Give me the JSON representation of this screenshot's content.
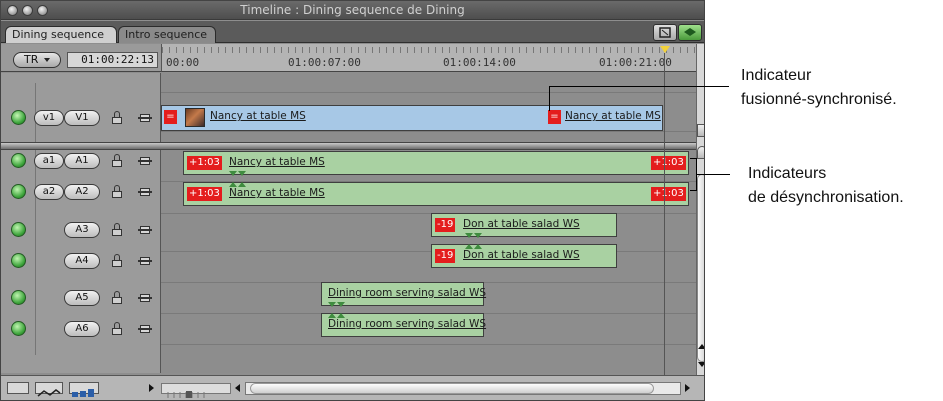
{
  "window": {
    "title": "Timeline : Dining sequence de Dining"
  },
  "tabs": [
    {
      "label": "Dining sequence",
      "active": true
    },
    {
      "label": "Intro sequence",
      "active": false
    }
  ],
  "header": {
    "rt_popup": "TR",
    "timecode": "01:00:22:13",
    "ruler_labels": [
      "00:00",
      "01:00:07:00",
      "01:00:14:00",
      "01:00:21:00"
    ]
  },
  "tracks": {
    "video": [
      {
        "src": "v1",
        "dst": "V1"
      }
    ],
    "audio": [
      {
        "src": "a1",
        "dst": "A1"
      },
      {
        "src": "a2",
        "dst": "A2"
      },
      {
        "src": "",
        "dst": "A3"
      },
      {
        "src": "",
        "dst": "A4"
      },
      {
        "src": "",
        "dst": "A5"
      },
      {
        "src": "",
        "dst": "A6"
      }
    ]
  },
  "clips": {
    "v1_a": {
      "name": "Nancy at table MS",
      "badge": "="
    },
    "v1_b": {
      "name": "Nancy at table MS",
      "badge": "="
    },
    "a1": {
      "name": "Nancy at table MS",
      "badge_in": "+1:03",
      "badge_out": "+1:03"
    },
    "a2": {
      "name": "Nancy at table MS",
      "badge_in": "+1:03",
      "badge_out": "+1:03"
    },
    "a3": {
      "name": "Don at table salad WS",
      "badge": "-19"
    },
    "a4": {
      "name": "Don at table salad WS",
      "badge": "-19"
    },
    "a5": {
      "name": "Dining room serving salad WS"
    },
    "a6": {
      "name": "Dining room serving salad WS"
    }
  },
  "callouts": {
    "merged": [
      "Indicateur",
      "fusionné-synchronisé."
    ],
    "desync": [
      "Indicateurs",
      "de désynchronisation."
    ]
  },
  "colors": {
    "video_clip": "#a7c8e6",
    "audio_clip": "#a9d1a2",
    "sync_badge": "#e41d1d",
    "playhead_marker": "#f2d23a"
  },
  "icons": {
    "audio_enable": "speaker-icon",
    "video_enable": "eye-icon",
    "lock": "lock-icon",
    "auto_select": "target-icon"
  }
}
